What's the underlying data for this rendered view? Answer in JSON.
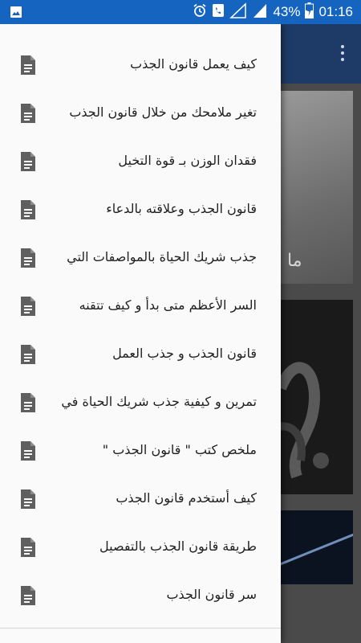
{
  "status_bar": {
    "battery_percent": "43%",
    "time": "01:16",
    "icons": [
      "image-icon",
      "alarm-icon",
      "phone-call-icon",
      "no-signal-icon",
      "signal-icon",
      "battery-charging-icon"
    ]
  },
  "background": {
    "card_text": "ما"
  },
  "drawer": {
    "items": [
      {
        "label": "كيف يعمل قانون الجذب"
      },
      {
        "label": "تغير ملامحك من خلال قانون الجذب"
      },
      {
        "label": "فقدان الوزن بـ قوة التخيل"
      },
      {
        "label": "قانون الجذب وعلاقته بالدعاء"
      },
      {
        "label": "جذب شريك الحياة بالمواصفات التي"
      },
      {
        "label": "السر الأعظم متى بدأ و كيف تتقنه"
      },
      {
        "label": "قانون الجذب و جذب العمل"
      },
      {
        "label": "تمرين و كيفية جذب شريك الحياة في"
      },
      {
        "label": "ملخص كتب \" قانون الجذب \""
      },
      {
        "label": "كيف أستخدم قانون الجذب"
      },
      {
        "label": "طريقة قانون الجذب بالتفصيل"
      },
      {
        "label": "سر قانون الجذب"
      }
    ],
    "item_icon": "document-icon"
  },
  "colors": {
    "status_bar": "#1565c0",
    "drawer_bg": "#fafafa",
    "icon_gray": "#5f5f5f"
  }
}
